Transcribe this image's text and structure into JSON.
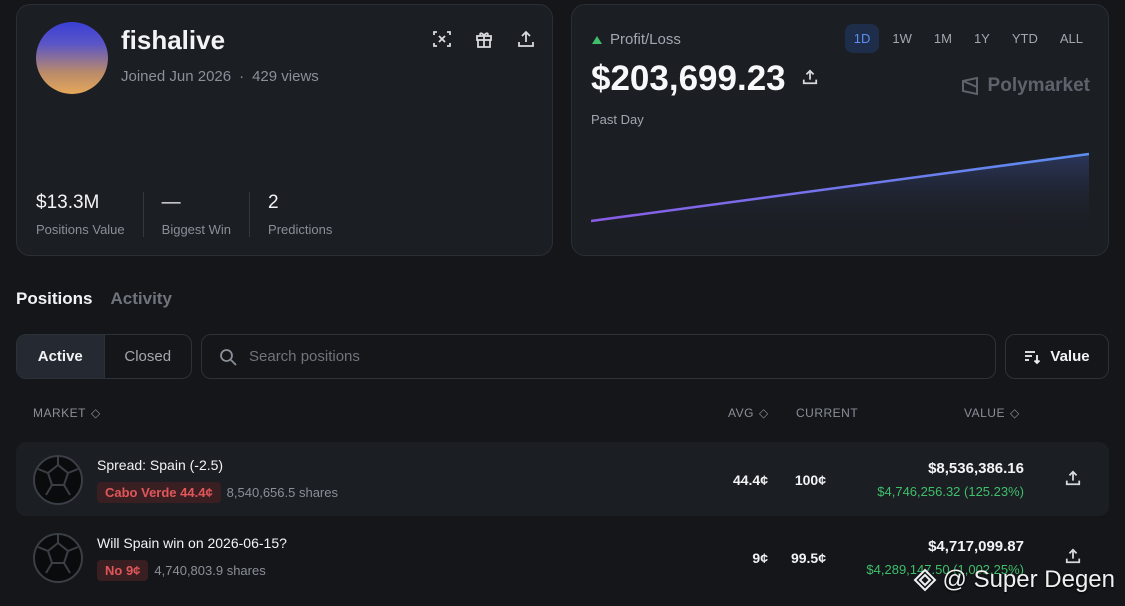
{
  "profile": {
    "username": "fishalive",
    "joined": "Joined Jun 2026",
    "separator": "·",
    "views": "429 views",
    "stats": [
      {
        "value": "$13.3M",
        "label": "Positions Value"
      },
      {
        "value": "—",
        "label": "Biggest Win"
      },
      {
        "value": "2",
        "label": "Predictions"
      }
    ]
  },
  "pnl": {
    "label": "Profit/Loss",
    "value": "$203,699.23",
    "period": "Past Day",
    "brand": "Polymarket",
    "ranges": [
      "1D",
      "1W",
      "1M",
      "1Y",
      "YTD",
      "ALL"
    ],
    "active_range": "1D",
    "line_color": "#5b8ff0",
    "up_color": "#3fbf6a"
  },
  "tabs": [
    "Positions",
    "Activity"
  ],
  "filters": {
    "active_label": "Active",
    "closed_label": "Closed",
    "search_placeholder": "Search positions",
    "sort_label": "Value"
  },
  "table": {
    "headers": {
      "market": "MARKET",
      "avg": "AVG",
      "current": "CURRENT",
      "value": "VALUE"
    },
    "rows": [
      {
        "title": "Spread: Spain (-2.5)",
        "outcome": "Cabo Verde 44.4¢",
        "shares": "8,540,656.5 shares",
        "avg": "44.4¢",
        "current": "100¢",
        "value": "$8,536,386.16",
        "pnl": "$4,746,256.32 (125.23%)"
      },
      {
        "title": "Will Spain win on 2026-06-15?",
        "outcome": "No 9¢",
        "shares": "4,740,803.9 shares",
        "avg": "9¢",
        "current": "99.5¢",
        "value": "$4,717,099.87",
        "pnl": "$4,289,147.50 (1,002.25%)"
      }
    ]
  },
  "watermark": "@ Super Degen"
}
